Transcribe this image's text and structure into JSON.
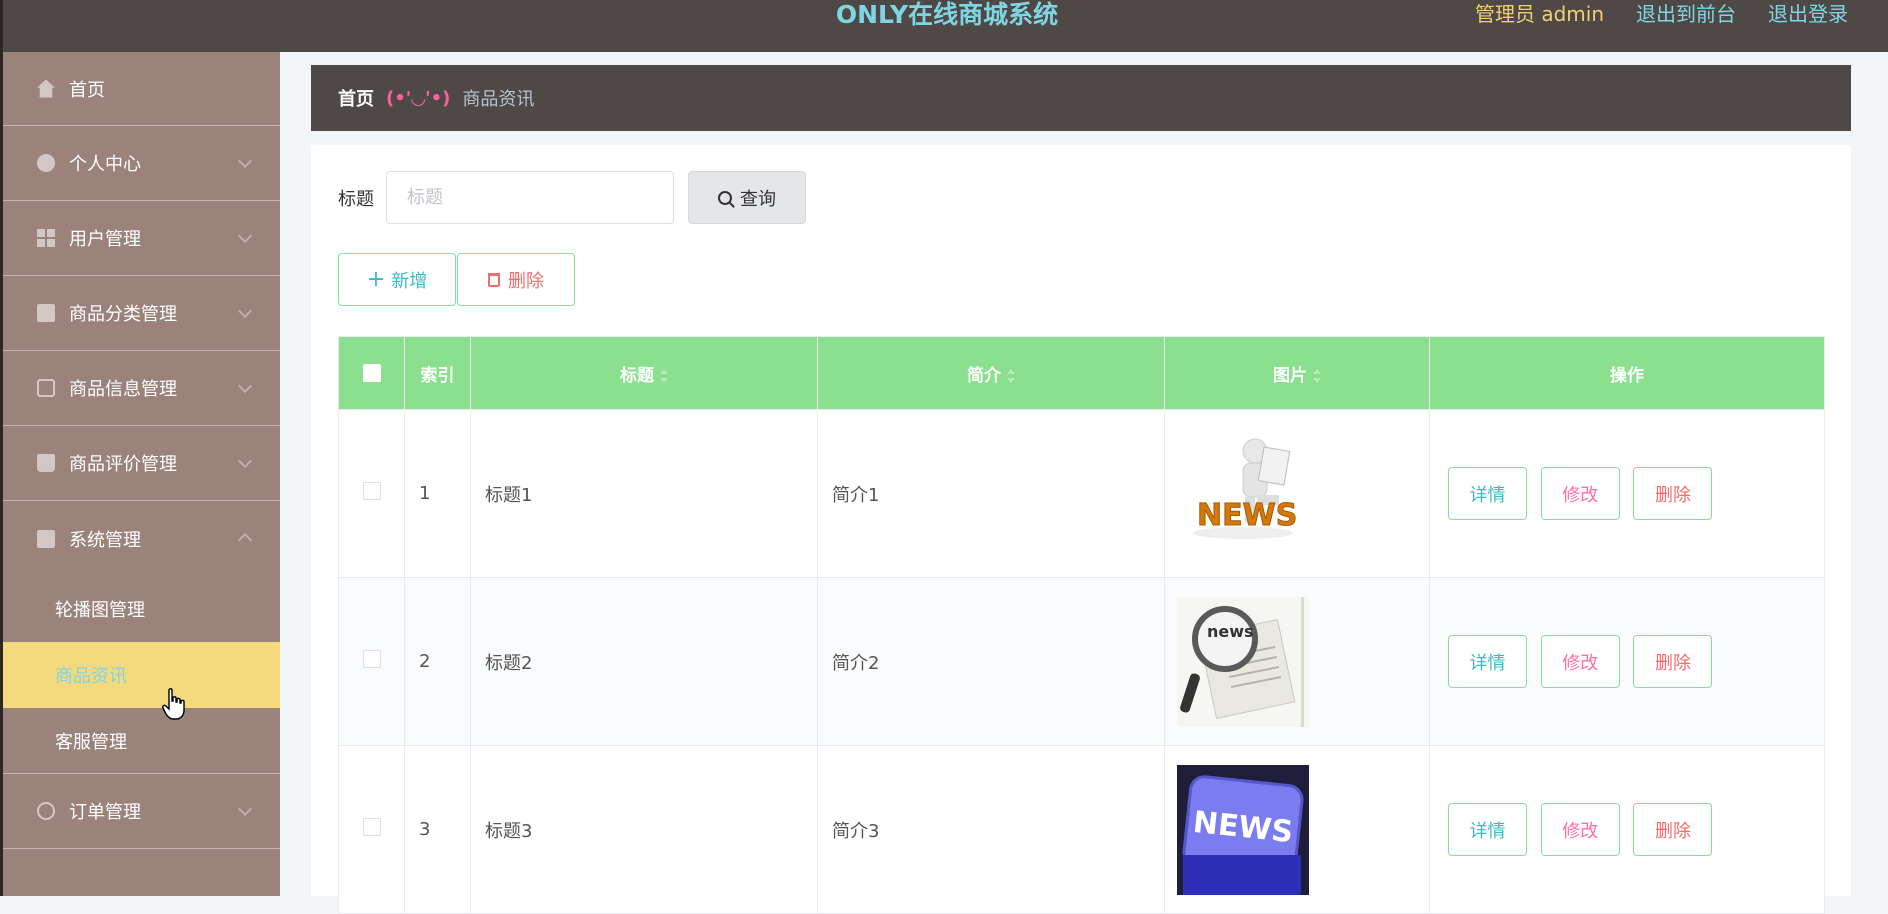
{
  "header": {
    "title": "ONLY在线商城系统",
    "admin": "管理员 admin",
    "to_front": "退出到前台",
    "logout": "退出登录"
  },
  "sidebar": {
    "items": [
      {
        "label": "首页",
        "icon": "home-icon"
      },
      {
        "label": "个人中心",
        "icon": "user-icon"
      },
      {
        "label": "用户管理",
        "icon": "grid-icon"
      },
      {
        "label": "商品分类管理",
        "icon": "checklist-icon"
      },
      {
        "label": "商品信息管理",
        "icon": "chat-icon"
      },
      {
        "label": "商品评价管理",
        "icon": "bag-icon"
      },
      {
        "label": "系统管理",
        "icon": "clipboard-icon"
      },
      {
        "label": "订单管理",
        "icon": "ring-icon"
      }
    ],
    "sub_items": [
      {
        "label": "轮播图管理"
      },
      {
        "label": "商品资讯",
        "active": true
      },
      {
        "label": "客服管理"
      }
    ]
  },
  "breadcrumb": {
    "home": "首页",
    "separator": "(•'◡'•)",
    "current": "商品资讯"
  },
  "search": {
    "label": "标题",
    "placeholder": "标题",
    "value": "",
    "button": "查询"
  },
  "actions": {
    "add": "新增",
    "delete": "删除"
  },
  "table": {
    "columns": [
      "索引",
      "标题",
      "简介",
      "图片",
      "操作"
    ],
    "rows": [
      {
        "index": "1",
        "title": "标题1",
        "intro": "简介1",
        "image": "news-figure-image"
      },
      {
        "index": "2",
        "title": "标题2",
        "intro": "简介2",
        "image": "news-magnifier-image"
      },
      {
        "index": "3",
        "title": "标题3",
        "intro": "简介3",
        "image": "news-key-image"
      }
    ],
    "ops": {
      "detail": "详情",
      "edit": "修改",
      "delete": "删除"
    }
  },
  "colors": {
    "header_bg": "#4e4946",
    "sidebar_bg": "#9b837c",
    "active_item_bg": "#f4da7c",
    "title_color": "#7fd6e3",
    "table_header_bg": "#8ae08e"
  }
}
